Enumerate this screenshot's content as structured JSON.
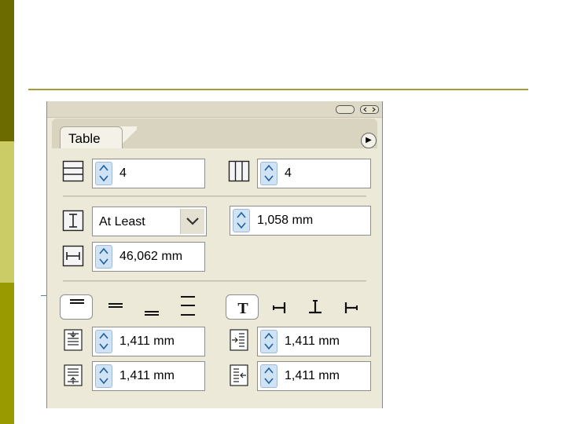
{
  "panel": {
    "tab_label": "Table",
    "menu_icon": "flyout-menu-icon"
  },
  "rows": {
    "body_rows": "4",
    "columns": "4"
  },
  "row_height": {
    "mode": "At Least",
    "value": "1,058 mm"
  },
  "column_width": {
    "value": "46,062 mm"
  },
  "vertical_alignment": {
    "options": [
      "align-top",
      "align-center",
      "align-bottom",
      "justify-vertical"
    ],
    "selected": "align-top"
  },
  "text_rotation": {
    "options": [
      "rotate-0",
      "rotate-90",
      "rotate-180",
      "rotate-270"
    ],
    "selected": "rotate-0"
  },
  "cell_insets": {
    "top": "1,411 mm",
    "bottom": "1,411 mm",
    "left": "1,411 mm",
    "right": "1,411 mm"
  }
}
